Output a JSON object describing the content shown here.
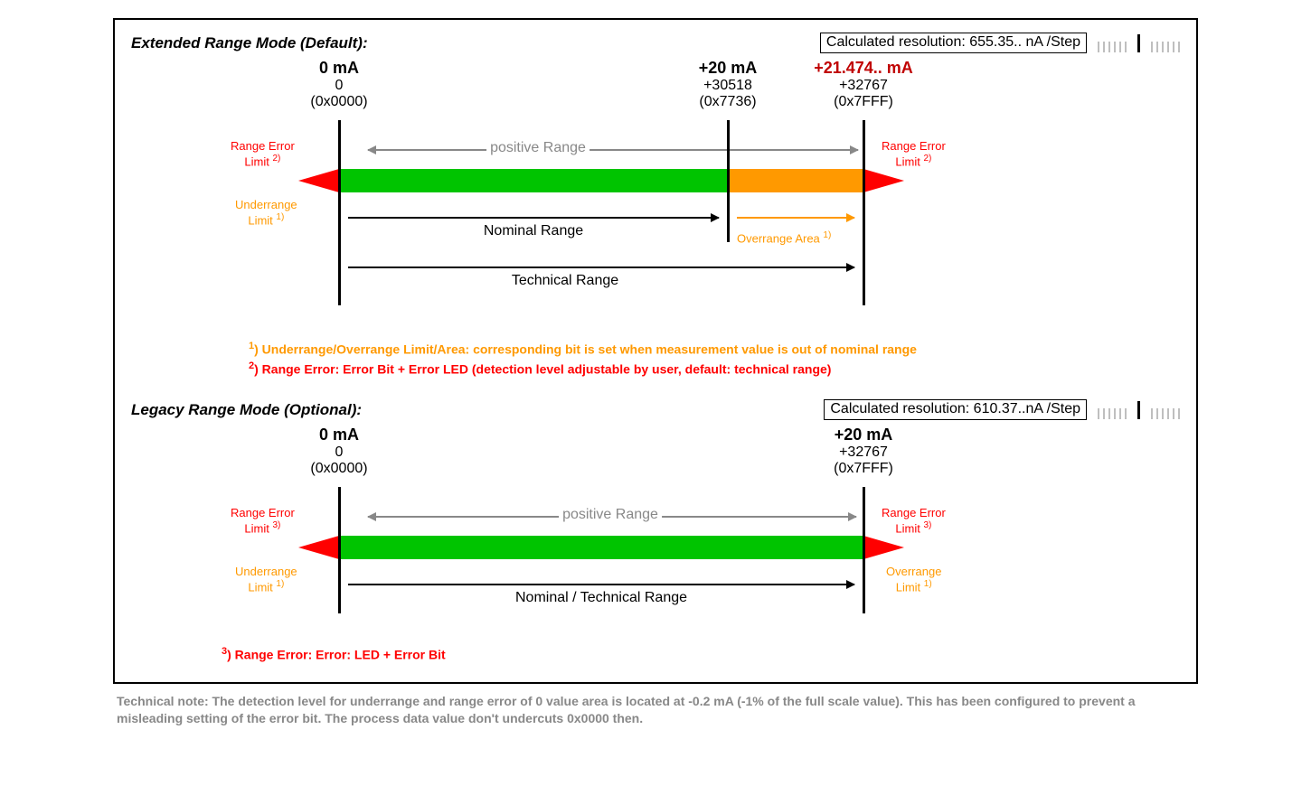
{
  "ext": {
    "title": "Extended Range Mode (Default):",
    "resolution": "Calculated resolution: 655.35.. nA /Step",
    "points": {
      "p0": {
        "ma": "0 mA",
        "dec": "0",
        "hex": "(0x0000)"
      },
      "p1": {
        "ma": "+20 mA",
        "dec": "+30518",
        "hex": "(0x7736)"
      },
      "p2": {
        "ma": "+21.474.. mA",
        "dec": "+32767",
        "hex": "(0x7FFF)"
      }
    },
    "labels": {
      "range_error_left": "Range Error",
      "limit2_left": "Limit ",
      "note2_left": "2)",
      "underrange": "Underrange",
      "limit1_left": "Limit ",
      "note1_left": "1)",
      "positive_range": "positive Range",
      "nominal_range": "Nominal Range",
      "overrange_area": "Overrange Area ",
      "note1_ov": "1)",
      "technical_range": "Technical Range",
      "range_error_right": "Range Error",
      "limit2_right": "Limit ",
      "note2_right": "2)"
    },
    "footnotes": {
      "fn1_pre": "1",
      "fn1": ") Underrange/Overrange Limit/Area: corresponding bit is set when measurement value is out of nominal range",
      "fn2_pre": "2",
      "fn2": ") Range Error: Error Bit + Error LED (detection level adjustable by user, default: technical range)"
    }
  },
  "leg": {
    "title": "Legacy Range Mode (Optional):",
    "resolution": "Calculated resolution: 610.37..nA /Step",
    "points": {
      "p0": {
        "ma": "0 mA",
        "dec": "0",
        "hex": "(0x0000)"
      },
      "p1": {
        "ma": "+20 mA",
        "dec": "+32767",
        "hex": "(0x7FFF)"
      }
    },
    "labels": {
      "range_error_left": "Range Error",
      "limit3_left": "Limit ",
      "note3_left": "3)",
      "underrange": "Underrange",
      "limit1_left": "Limit ",
      "note1_left": "1)",
      "positive_range": "positive Range",
      "nominal_tech": "Nominal / Technical Range",
      "range_error_right": "Range Error",
      "limit3_right": "Limit ",
      "note3_right": "3)",
      "overrange": "Overrange",
      "limit1_right": "Limit ",
      "note1_right": "1)"
    },
    "footnotes": {
      "fn3_pre": "3",
      "fn3": ") Range Error: Error: LED + Error Bit"
    }
  },
  "technote": "Technical note: The detection level for underrange and range error of 0 value area is located at -0.2 mA (-1% of the full scale value). This has been configured to prevent a misleading setting of the error bit. The process data value don't undercuts 0x0000 then."
}
